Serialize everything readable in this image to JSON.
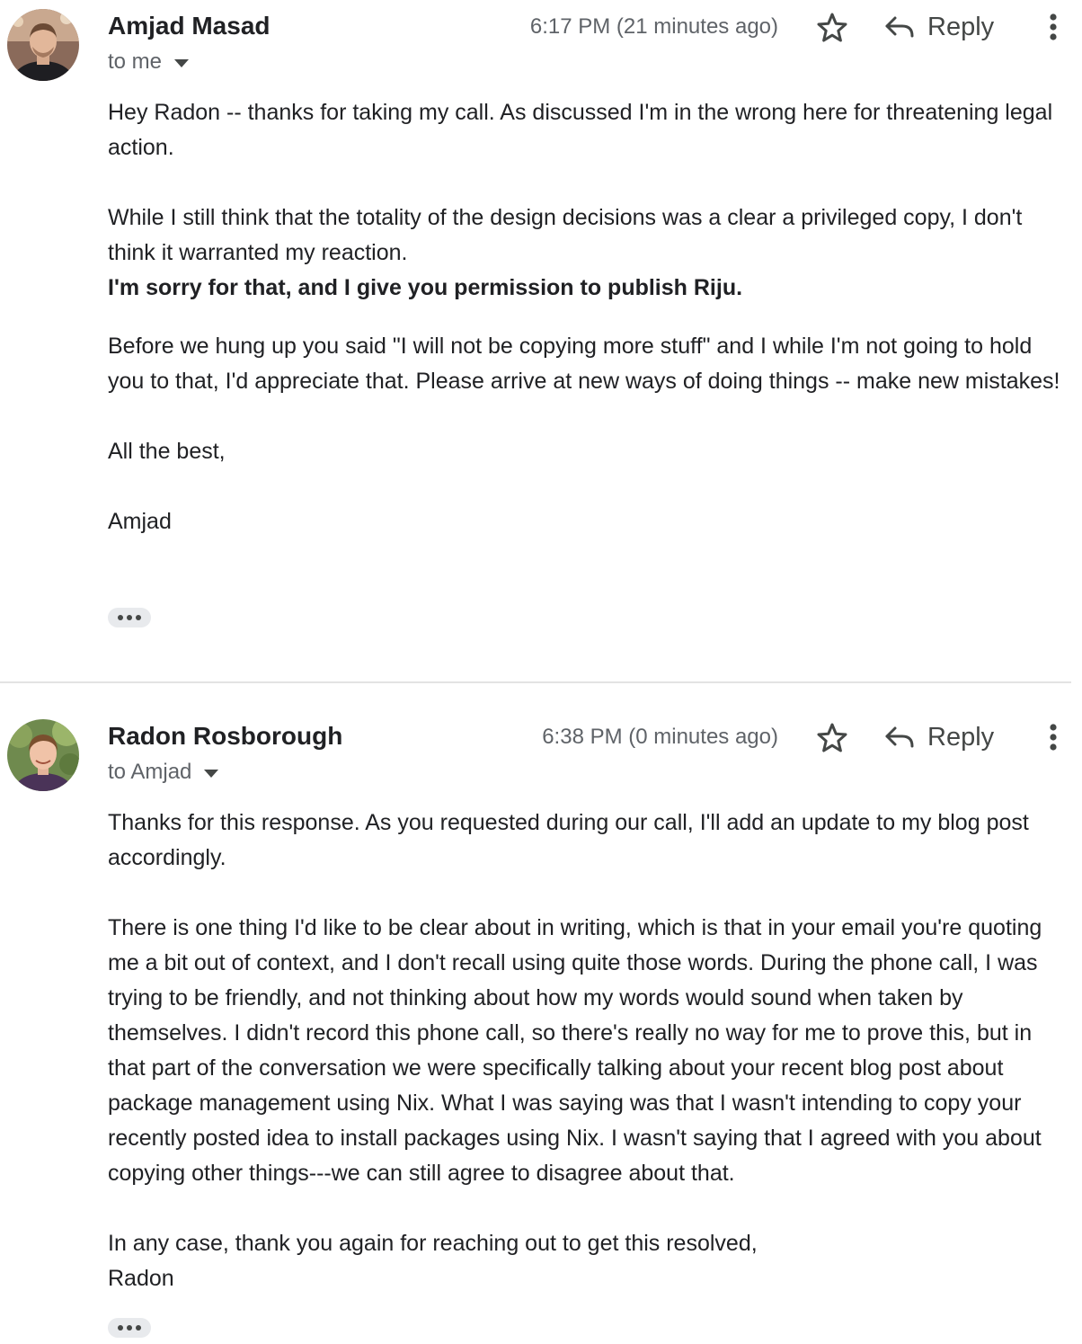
{
  "messages": [
    {
      "sender": "Amjad Masad",
      "recipient": "to me",
      "timestamp": "6:17 PM (21 minutes ago)",
      "reply_label": "Reply",
      "avatar_icon": "user-avatar",
      "body": {
        "p1": "Hey Radon -- thanks for taking my call. As discussed I'm in the wrong here for threatening legal action.",
        "p2": "While I still think that the totality of the design decisions was a clear a privileged copy, I don't think it warranted my reaction.",
        "p2_bold": "I'm sorry for that, and I give you permission to publish Riju.",
        "p3": "Before we hung up you said \"I will not be copying more stuff\" and I while I'm not going to hold you to that, I'd appreciate that. Please arrive at new ways of doing things -- make new mistakes!",
        "p4": "All the best,",
        "p5": "Amjad"
      }
    },
    {
      "sender": "Radon Rosborough",
      "recipient": "to Amjad",
      "timestamp": "6:38 PM (0 minutes ago)",
      "reply_label": "Reply",
      "avatar_icon": "user-avatar",
      "body": {
        "p1": "Thanks for this response. As you requested during our call, I'll add an update to my blog post accordingly.",
        "p2": "There is one thing I'd like to be clear about in writing, which is that in your email you're quoting me a bit out of context, and I don't recall using quite those words. During the phone call, I was trying to be friendly, and not thinking about how my words would sound when taken by themselves. I didn't record this phone call, so there's really no way for me to prove this, but in that part of the conversation we were specifically talking about your recent blog post about package management using Nix. What I was saying was that I wasn't intending to copy your recently posted idea to install packages using Nix. I wasn't saying that I agreed with you about copying other things---we can still agree to disagree about that.",
        "p3": "In any case, thank you again for reaching out to get this resolved,",
        "p4": "Radon"
      }
    }
  ],
  "colors": {
    "text": "#202124",
    "secondary_text": "#5f6368",
    "icon": "#444746",
    "divider": "#e3e3e3",
    "ellipsis_bg": "#e8eaed"
  }
}
